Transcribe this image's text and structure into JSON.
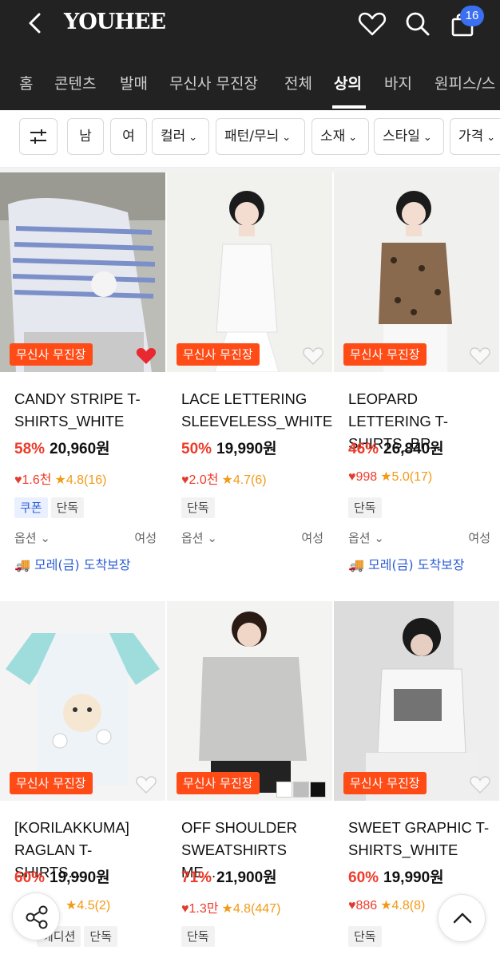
{
  "brand": "YOUHEE",
  "cart_count": "16",
  "categories": [
    "홈",
    "콘텐츠",
    "발매",
    "무신사 무진장",
    "전체",
    "상의",
    "바지",
    "원피스/스"
  ],
  "filters": [
    "남",
    "여",
    "컬러",
    "패턴/무늬",
    "소재",
    "스타일",
    "가격"
  ],
  "badge_label": "무신사 무진장",
  "option_label": "옵션",
  "products": [
    {
      "title": "CANDY STRIPE T-SHIRTS_WHITE",
      "discount": "58%",
      "price": "20,960원",
      "likes": "1.6천",
      "rating": "4.8(16)",
      "tags": [
        "쿠폰",
        "단독"
      ],
      "gender": "여성",
      "delivery": "모레(금) 도착보장",
      "liked": true
    },
    {
      "title": "LACE LETTERING SLEEVELESS_WHITE",
      "discount": "50%",
      "price": "19,990원",
      "likes": "2.0천",
      "rating": "4.7(6)",
      "tags": [
        "단독"
      ],
      "gender": "여성",
      "delivery": "",
      "liked": false
    },
    {
      "title": "LEOPARD LETTERING T-SHIRTS_BR...",
      "discount": "46%",
      "price": "26,840원",
      "likes": "998",
      "rating": "5.0(17)",
      "tags": [
        "단독"
      ],
      "gender": "여성",
      "delivery": "모레(금) 도착보장",
      "liked": false
    },
    {
      "title": "[KORILAKKUMA] RAGLAN T-SHIRTS...",
      "discount": "60%",
      "price": "19,990원",
      "likes": "",
      "rating": "4.5(2)",
      "tags": [
        "에디션",
        "단독"
      ],
      "gender": "",
      "delivery": "",
      "liked": false
    },
    {
      "title": "OFF SHOULDER SWEATSHIRTS ME...",
      "discount": "71%",
      "price": "21,900원",
      "likes": "1.3만",
      "rating": "4.8(447)",
      "tags": [
        "단독"
      ],
      "gender": "",
      "delivery": "",
      "liked": false
    },
    {
      "title": "SWEET GRAPHIC T-SHIRTS_WHITE",
      "discount": "60%",
      "price": "19,990원",
      "likes": "886",
      "rating": "4.8(8)",
      "tags": [
        "단독"
      ],
      "gender": "",
      "delivery": "",
      "liked": false
    }
  ],
  "colors": {
    "accent_red": "#ee3b2a",
    "badge_orange": "#ff4b16",
    "header_bg": "#222222",
    "cart_badge": "#3a6ff0",
    "delivery_blue": "#2b5cd6"
  }
}
